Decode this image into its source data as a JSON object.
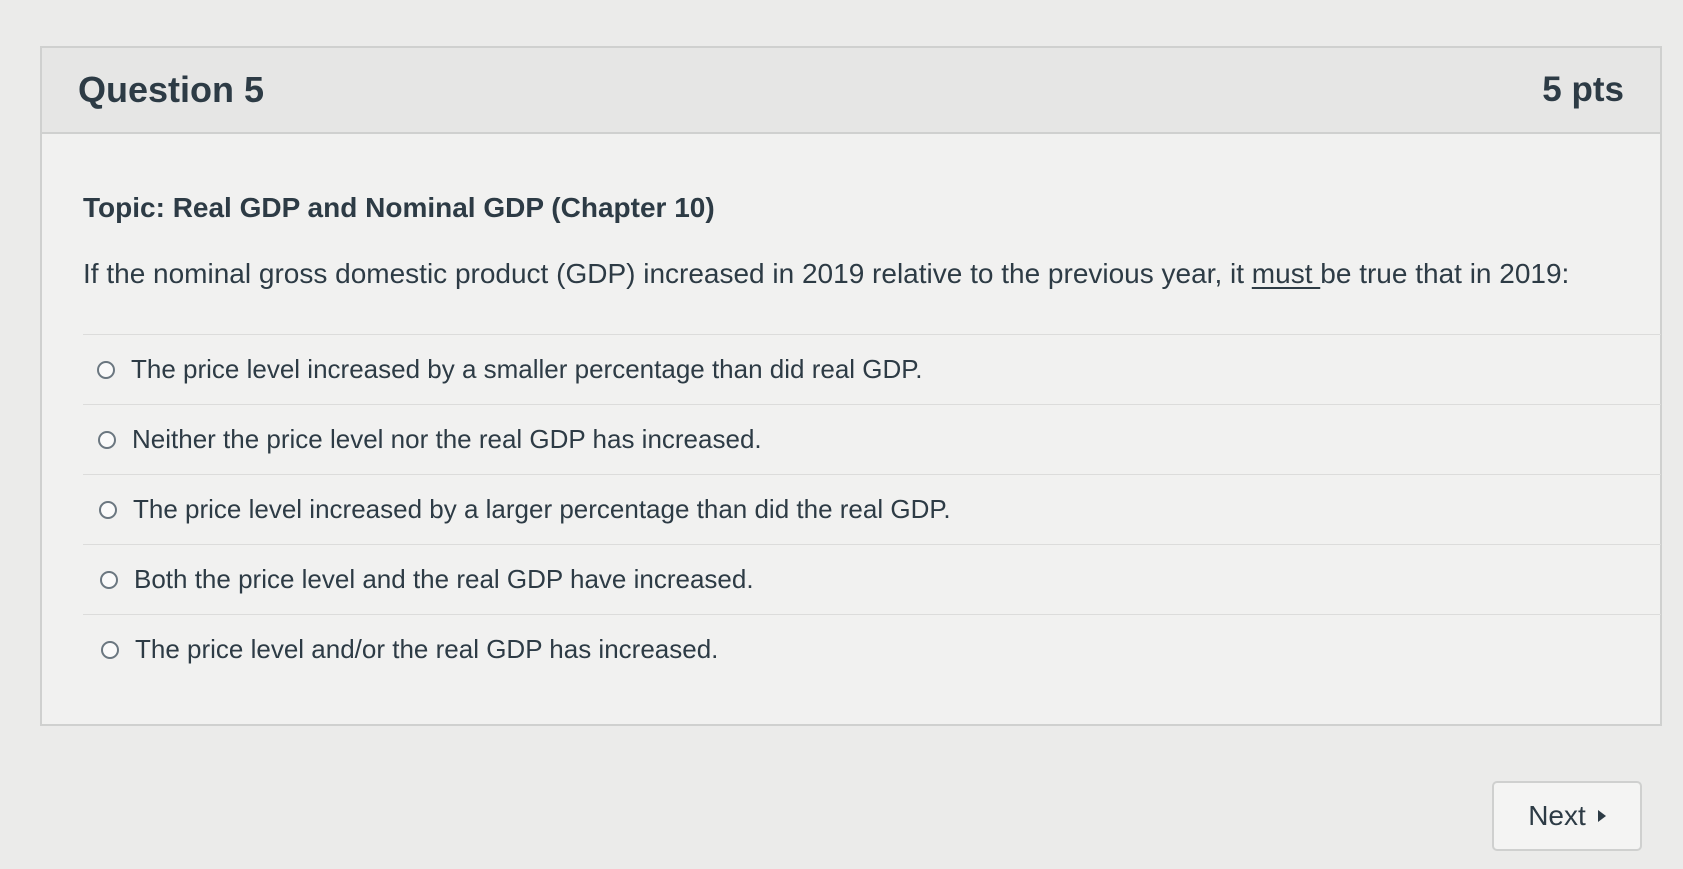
{
  "question": {
    "title": "Question 5",
    "points": "5 pts",
    "topic": "Topic: Real GDP and Nominal GDP (Chapter 10)",
    "prompt_before": "If the nominal gross domestic product (GDP) increased in 2019 relative to the previous year, it ",
    "prompt_emphasis": "must ",
    "prompt_after": "be true that in 2019:",
    "answers": [
      {
        "label": "The price level increased by a smaller percentage than did real GDP."
      },
      {
        "label": "Neither the price level nor the real GDP has increased."
      },
      {
        "label": "The price level increased by a larger percentage than did the real GDP."
      },
      {
        "label": "Both the price level and the real GDP have increased."
      },
      {
        "label": "The price level and/or the real GDP has increased."
      }
    ]
  },
  "navigation": {
    "next_label": "Next",
    "next_icon": "caret-right-icon"
  },
  "colors": {
    "text": "#2d3b45",
    "card_background": "#f1f1f0",
    "header_background": "#e6e6e5",
    "border": "#cfd0cf"
  }
}
